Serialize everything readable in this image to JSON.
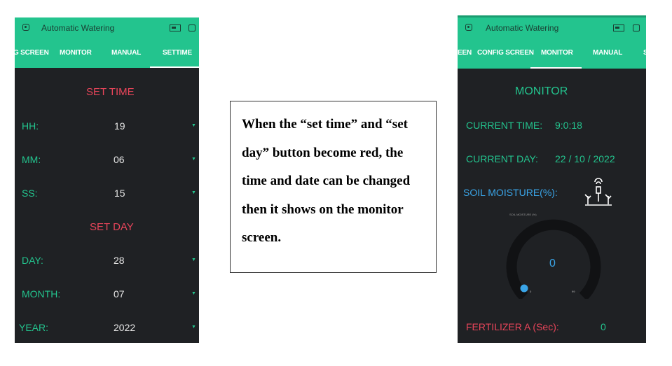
{
  "left_screen": {
    "app_title": "Automatic Watering",
    "tabs": [
      "G SCREEN",
      "MONITOR",
      "MANUAL",
      "SETTIME"
    ],
    "active_tab": "SETTIME",
    "set_time_header": "SET TIME",
    "hh_label": "HH:",
    "hh_value": "19",
    "mm_label": "MM:",
    "mm_value": "06",
    "ss_label": "SS:",
    "ss_value": "15",
    "set_day_header": "SET DAY",
    "day_label": "DAY:",
    "day_value": "28",
    "month_label": "MONTH:",
    "month_value": "07",
    "year_label": "YEAR:",
    "year_value": "2022"
  },
  "note": {
    "text": "When the “set time” and “set day” button become red, the time and date can be changed then it shows on the monitor screen."
  },
  "right_screen": {
    "app_title": "Automatic Watering",
    "tabs": [
      "EEN",
      "CONFIG SCREEN",
      "MONITOR",
      "MANUAL",
      "S"
    ],
    "active_tab": "MONITOR",
    "monitor_header": "MONITOR",
    "current_time_label": "CURRENT TIME:",
    "current_time_value": "9:0:18",
    "current_day_label": "CURRENT DAY:",
    "current_day_value": "22 / 10 / 2022",
    "soil_moisture_label": "SOIL MOISTURE(%):",
    "gauge_title": "SOIL MOISTURE (%)",
    "gauge_value": "0",
    "gauge_min": "0",
    "gauge_max": "99",
    "fertilizer_label": "FERTILIZER A (Sec):",
    "fertilizer_value": "0"
  },
  "colors": {
    "header_green": "#23c48e",
    "dark_bg": "#1f2124",
    "red_label": "#e8455a",
    "blue_accent": "#3aa5e8"
  },
  "icons": [
    "device-icon",
    "battery-icon",
    "square-icon",
    "dropdown-caret-icon",
    "plant-sensor-icon"
  ]
}
